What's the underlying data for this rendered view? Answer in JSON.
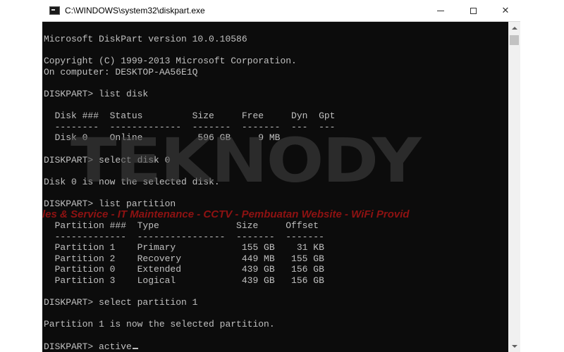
{
  "window": {
    "title": "C:\\WINDOWS\\system32\\diskpart.exe",
    "icon": "console-app-icon",
    "controls": {
      "minimize": "minimize-icon",
      "maximize": "maximize-icon",
      "close_glyph": "✕"
    }
  },
  "console": {
    "lines": [
      "Microsoft DiskPart version 10.0.10586",
      "",
      "Copyright (C) 1999-2013 Microsoft Corporation.",
      "On computer: DESKTOP-AA56E1Q",
      "",
      "DISKPART> list disk",
      "",
      "  Disk ###  Status         Size     Free     Dyn  Gpt",
      "  --------  -------------  -------  -------  ---  ---",
      "  Disk 0    Online          596 GB     9 MB",
      "",
      "DISKPART> select disk 0",
      "",
      "Disk 0 is now the selected disk.",
      "",
      "DISKPART> list partition",
      "",
      "  Partition ###  Type              Size     Offset",
      "  -------------  ----------------  -------  -------",
      "  Partition 1    Primary            155 GB    31 KB",
      "  Partition 2    Recovery           449 MB   155 GB",
      "  Partition 0    Extended           439 GB   156 GB",
      "  Partition 3    Logical            439 GB   156 GB",
      "",
      "DISKPART> select partition 1",
      "",
      "Partition 1 is now the selected partition.",
      "",
      "DISKPART> active"
    ],
    "text_color": "#c0c0c0",
    "background_color": "#0c0c0c"
  },
  "watermark": {
    "logo": "TEKNODY",
    "tagline": "les & Service - IT Maintenance - CCTV - Pembuatan Website - WiFi Provid",
    "tagline_color": "#b91414"
  }
}
